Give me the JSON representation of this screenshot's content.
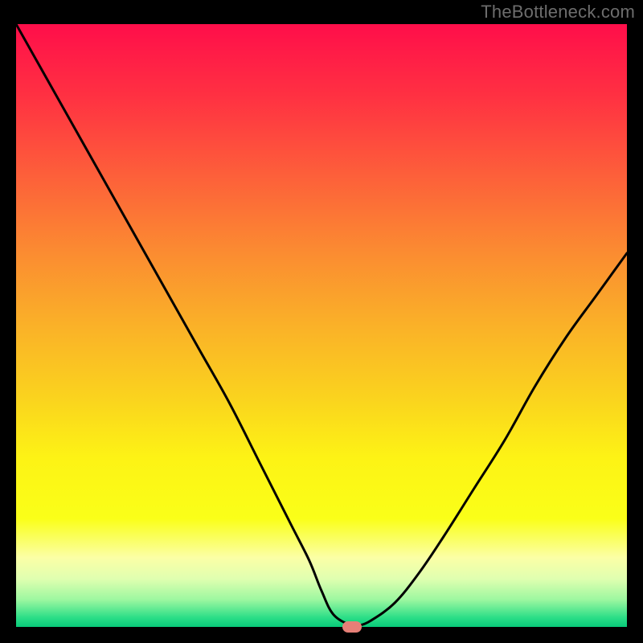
{
  "watermark": "TheBottleneck.com",
  "chart_data": {
    "type": "line",
    "title": "",
    "xlabel": "",
    "ylabel": "",
    "xlim": [
      0,
      100
    ],
    "ylim": [
      0,
      100
    ],
    "grid": false,
    "legend": false,
    "series": [
      {
        "name": "curve",
        "x": [
          0,
          5,
          10,
          15,
          20,
          25,
          30,
          35,
          40,
          45,
          48,
          50,
          52,
          55,
          56,
          58,
          62,
          66,
          70,
          75,
          80,
          85,
          90,
          95,
          100
        ],
        "y": [
          100,
          91,
          82,
          73,
          64,
          55,
          46,
          37,
          27,
          17,
          11,
          6,
          2,
          0.2,
          0.2,
          1,
          4,
          9,
          15,
          23,
          31,
          40,
          48,
          55,
          62
        ]
      }
    ],
    "flat_bottom_range": [
      50,
      55
    ],
    "marker": {
      "x": 55,
      "y": 0,
      "color": "#e67f77"
    },
    "background_gradient": {
      "stops": [
        {
          "offset": 0.0,
          "color": "#ff0e4a"
        },
        {
          "offset": 0.12,
          "color": "#ff3142"
        },
        {
          "offset": 0.25,
          "color": "#fd5f3a"
        },
        {
          "offset": 0.38,
          "color": "#fb8c31"
        },
        {
          "offset": 0.5,
          "color": "#fab128"
        },
        {
          "offset": 0.62,
          "color": "#fad31e"
        },
        {
          "offset": 0.72,
          "color": "#fdf315"
        },
        {
          "offset": 0.82,
          "color": "#faff18"
        },
        {
          "offset": 0.885,
          "color": "#fbffa6"
        },
        {
          "offset": 0.92,
          "color": "#e0ffb0"
        },
        {
          "offset": 0.955,
          "color": "#9cf7a0"
        },
        {
          "offset": 0.985,
          "color": "#2ade87"
        },
        {
          "offset": 1.0,
          "color": "#08c979"
        }
      ]
    }
  }
}
